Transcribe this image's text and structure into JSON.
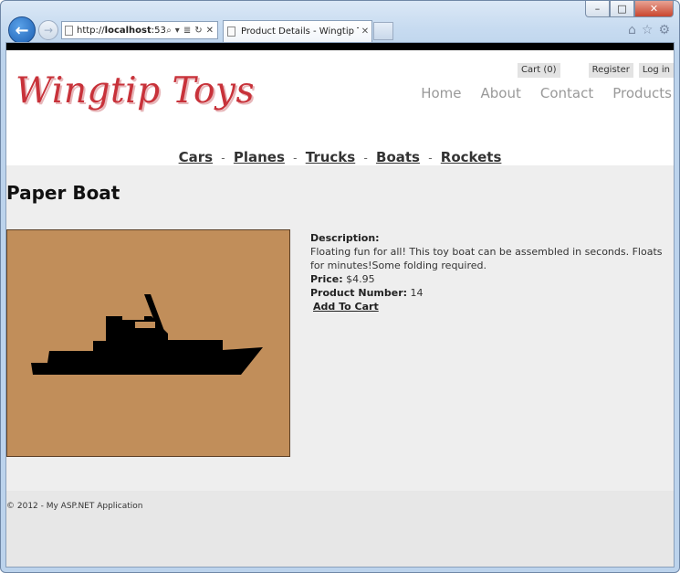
{
  "browser": {
    "url_prefix": "http://",
    "url_host": "localhost",
    "url_rest": ":53",
    "tab_title": "Product Details - Wingtip T...",
    "tab_close": "✕",
    "minimize": "–",
    "restore": "□",
    "close": "✕"
  },
  "site": {
    "logo": "Wingtip Toys",
    "cart": "Cart (0)",
    "register": "Register",
    "login": "Log in",
    "nav": [
      "Home",
      "About",
      "Contact",
      "Products"
    ],
    "categories": [
      "Cars",
      "Planes",
      "Trucks",
      "Boats",
      "Rockets"
    ]
  },
  "product": {
    "title": "Paper Boat",
    "description_label": "Description:",
    "description": "Floating fun for all! This toy boat can be assembled in seconds. Floats for minutes!Some folding required.",
    "price_label": "Price:",
    "price": "$4.95",
    "number_label": "Product Number:",
    "number": "14",
    "add_to_cart": "Add To Cart"
  },
  "footer": {
    "text": "© 2012 - My ASP.NET Application"
  },
  "colors": {
    "logo": "#c8323a",
    "image_bg": "#c18e5a",
    "page_bg": "#eeeeee"
  }
}
